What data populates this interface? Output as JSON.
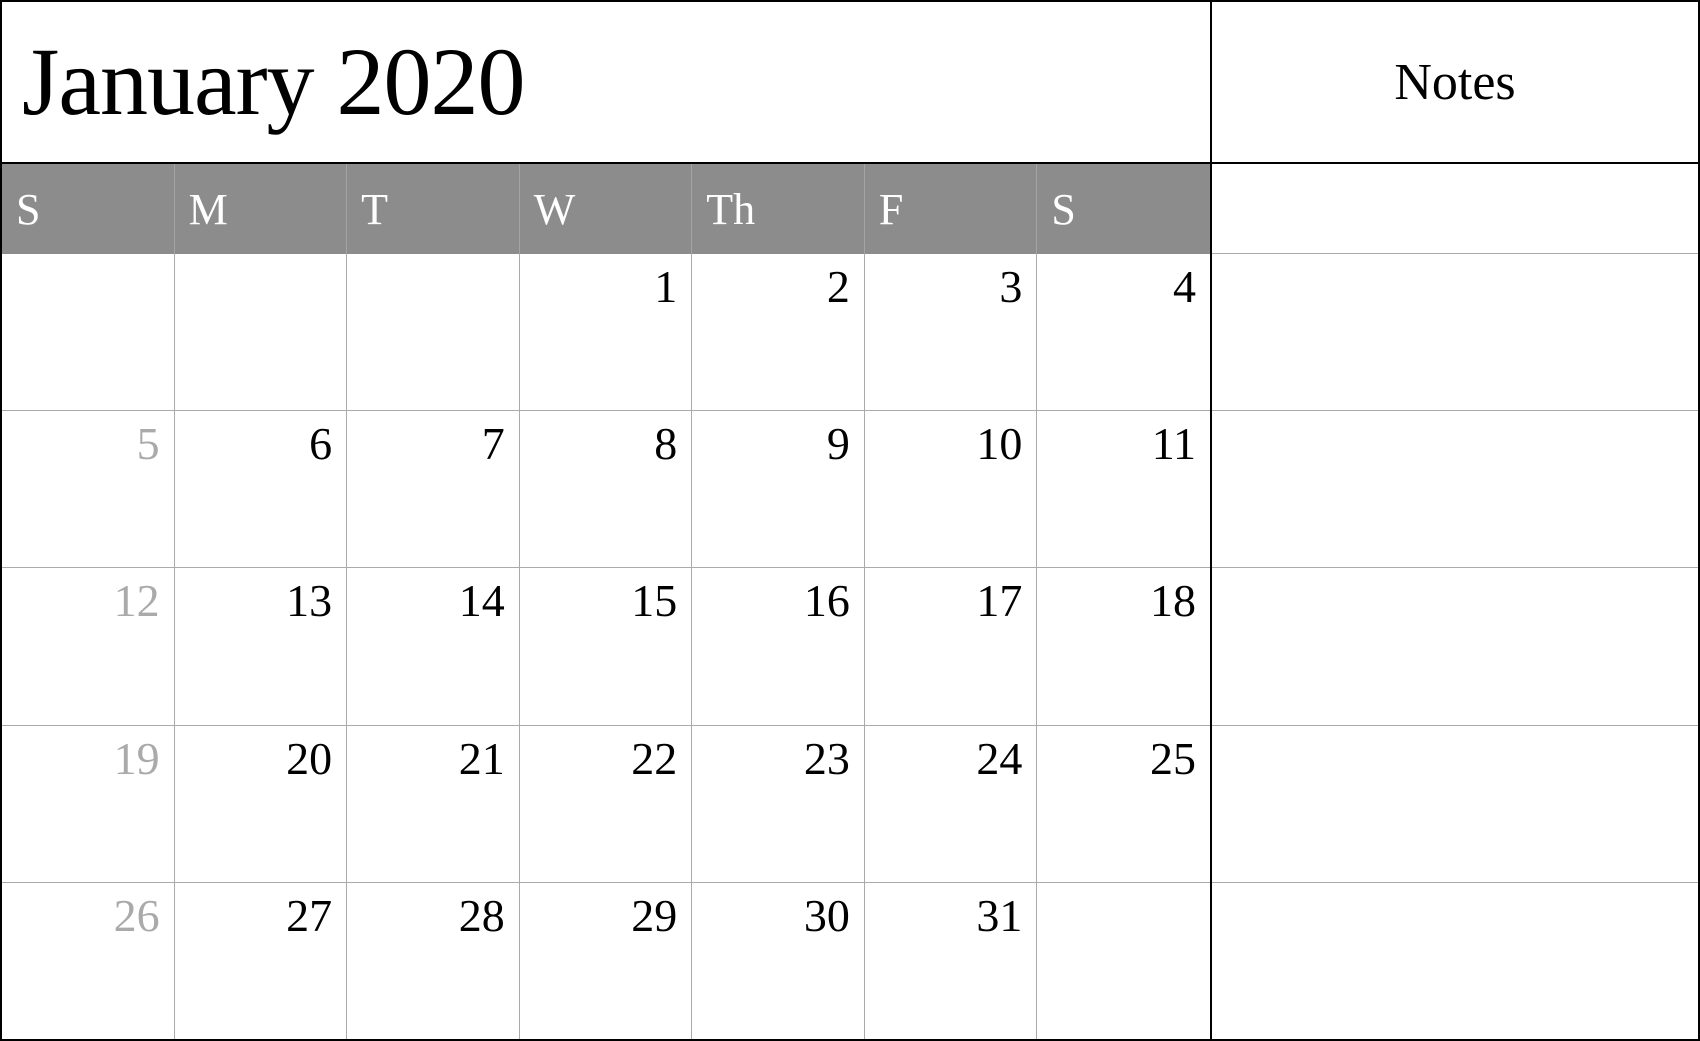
{
  "header": {
    "title": "January 2020",
    "notes_label": "Notes"
  },
  "day_headers": [
    "S",
    "M",
    "T",
    "W",
    "Th",
    "F",
    "S"
  ],
  "weeks": [
    [
      {
        "num": "",
        "faded": false,
        "empty": true
      },
      {
        "num": "",
        "faded": false,
        "empty": true
      },
      {
        "num": "",
        "faded": false,
        "empty": true
      },
      {
        "num": "1",
        "faded": false,
        "empty": false
      },
      {
        "num": "2",
        "faded": false,
        "empty": false
      },
      {
        "num": "3",
        "faded": false,
        "empty": false
      },
      {
        "num": "4",
        "faded": false,
        "empty": false
      }
    ],
    [
      {
        "num": "5",
        "faded": true,
        "empty": false
      },
      {
        "num": "6",
        "faded": false,
        "empty": false
      },
      {
        "num": "7",
        "faded": false,
        "empty": false
      },
      {
        "num": "8",
        "faded": false,
        "empty": false
      },
      {
        "num": "9",
        "faded": false,
        "empty": false
      },
      {
        "num": "10",
        "faded": false,
        "empty": false
      },
      {
        "num": "11",
        "faded": false,
        "empty": false
      }
    ],
    [
      {
        "num": "12",
        "faded": true,
        "empty": false
      },
      {
        "num": "13",
        "faded": false,
        "empty": false
      },
      {
        "num": "14",
        "faded": false,
        "empty": false
      },
      {
        "num": "15",
        "faded": false,
        "empty": false
      },
      {
        "num": "16",
        "faded": false,
        "empty": false
      },
      {
        "num": "17",
        "faded": false,
        "empty": false
      },
      {
        "num": "18",
        "faded": false,
        "empty": false
      }
    ],
    [
      {
        "num": "19",
        "faded": true,
        "empty": false
      },
      {
        "num": "20",
        "faded": false,
        "empty": false
      },
      {
        "num": "21",
        "faded": false,
        "empty": false
      },
      {
        "num": "22",
        "faded": false,
        "empty": false
      },
      {
        "num": "23",
        "faded": false,
        "empty": false
      },
      {
        "num": "24",
        "faded": false,
        "empty": false
      },
      {
        "num": "25",
        "faded": false,
        "empty": false
      }
    ],
    [
      {
        "num": "26",
        "faded": true,
        "empty": false
      },
      {
        "num": "27",
        "faded": false,
        "empty": false
      },
      {
        "num": "28",
        "faded": false,
        "empty": false
      },
      {
        "num": "29",
        "faded": false,
        "empty": false
      },
      {
        "num": "30",
        "faded": false,
        "empty": false
      },
      {
        "num": "31",
        "faded": false,
        "empty": false
      },
      {
        "num": "",
        "faded": false,
        "empty": true
      }
    ]
  ]
}
